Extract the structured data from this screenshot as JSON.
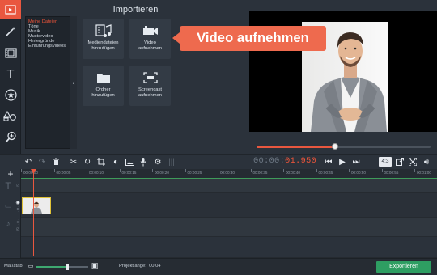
{
  "colors": {
    "accent": "#e9573f",
    "callout": "#ee6a4e",
    "export": "#2e9e62",
    "panel": "#2b323b"
  },
  "tools": [
    {
      "name": "import-icon",
      "glyph": "⇱"
    },
    {
      "name": "magic-wand-icon",
      "glyph": "✦"
    },
    {
      "name": "filmstrip-icon",
      "glyph": "▤"
    },
    {
      "name": "text-icon",
      "glyph": "T"
    },
    {
      "name": "sticker-star-icon",
      "glyph": "★"
    },
    {
      "name": "shapes-icon",
      "glyph": "◭"
    },
    {
      "name": "zoom-icon",
      "glyph": "⊕"
    },
    {
      "name": "more-icon",
      "glyph": "☰"
    }
  ],
  "import_panel": {
    "title": "Importieren",
    "categories": [
      "Meine Dateien",
      "Töne",
      "Musik",
      "Mustervideo",
      "Hintergründe",
      "Einführungsvideos"
    ],
    "tiles": [
      {
        "label_1": "Mediendateien",
        "label_2": "hinzufügen"
      },
      {
        "label_1": "Video",
        "label_2": "aufnehmen"
      },
      {
        "label_1": "Ordner",
        "label_2": "hinzufügen"
      },
      {
        "label_1": "Screencast",
        "label_2": "aufnehmen"
      }
    ]
  },
  "callout": {
    "text": "Video aufnehmen"
  },
  "player": {
    "progress": 0.45
  },
  "timecode": {
    "dim": "00:00:",
    "red": "01.950"
  },
  "aspect_ratio": "4:3",
  "ruler": [
    "00:00:00",
    "00:00:05",
    "00:00:10",
    "00:00:15",
    "00:00:20",
    "00:00:25",
    "00:00:30",
    "00:00:35",
    "00:00:40",
    "00:00:45",
    "00:00:50",
    "00:00:55",
    "00:01:00"
  ],
  "bottom": {
    "zoom_label": "Maßstab:",
    "zoom_level": 0.6,
    "project_length_label": "Projektlänge:",
    "project_length": "00:04",
    "export_label": "Exportieren"
  }
}
